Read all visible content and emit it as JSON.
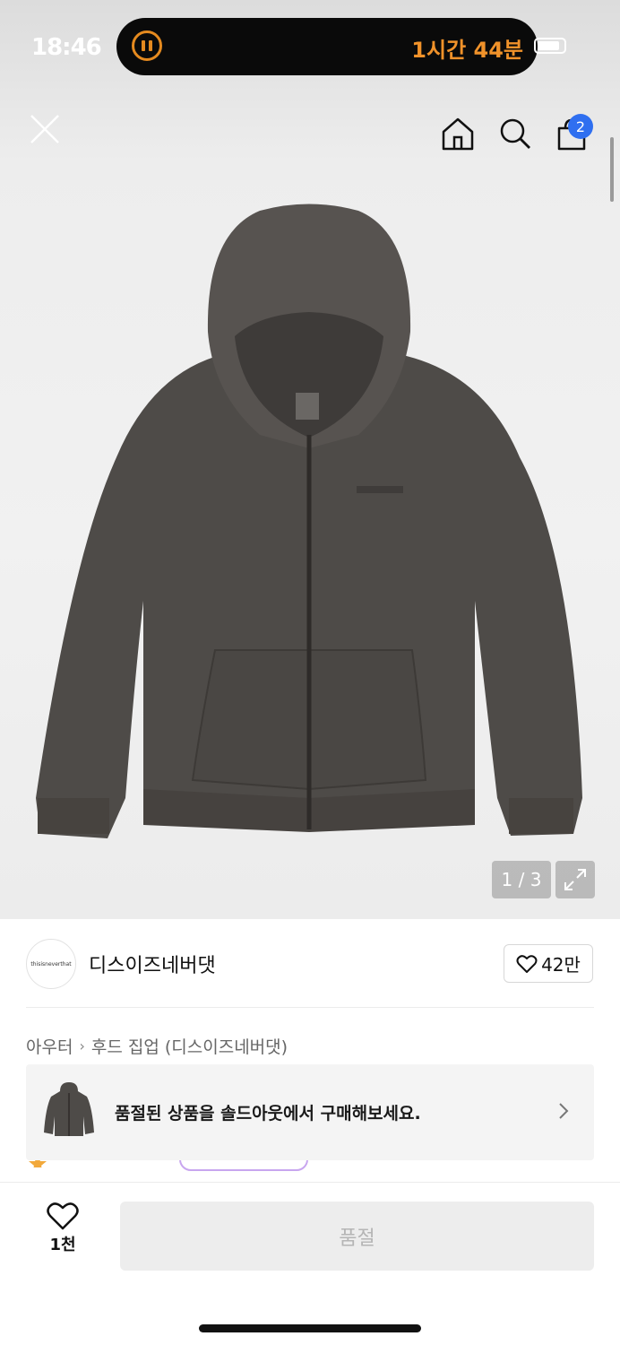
{
  "status_bar": {
    "time": "18:46",
    "timer": "1시간 44분"
  },
  "product": {
    "image_counter": "1 / 3"
  },
  "nav": {
    "cart_badge": "2"
  },
  "brand": {
    "logo_text": "thisisneverthat",
    "name": "디스이즈네버댓",
    "likes": "42만"
  },
  "breadcrumb": {
    "category": "아우터",
    "subcategory": "후드 집업 (디스이즈네버댓)"
  },
  "soldout_banner": {
    "text": "품절된 상품을 솔드아웃에서 구매해보세요."
  },
  "bottom": {
    "wish_count": "1천",
    "buy_label": "품절"
  },
  "colors": {
    "accent_blue": "#2f6ff0",
    "timer_orange": "#f0922a",
    "hoodie": "#4e4b48"
  }
}
